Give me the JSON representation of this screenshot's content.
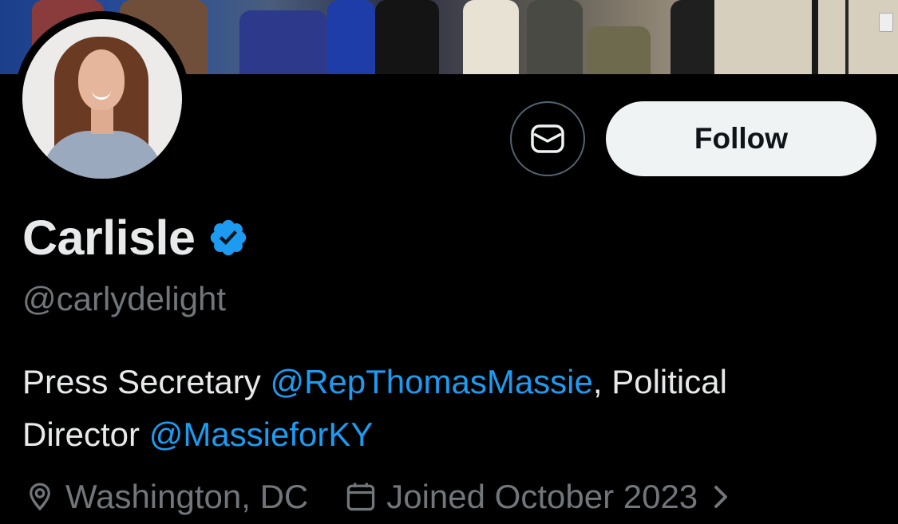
{
  "profile": {
    "display_name": "Carlisle",
    "handle": "@carlydelight",
    "verified": true,
    "verified_color": "#1d9bf0"
  },
  "actions": {
    "follow_label": "Follow",
    "message_icon": "envelope-icon"
  },
  "bio": {
    "line1_text": "Press Secretary ",
    "mention1": "@RepThomasMassie",
    "line1_tail": ", Political",
    "line2_text": "Director ",
    "mention2": "@MassieforKY"
  },
  "meta": {
    "location": "Washington, DC",
    "location_icon": "location-pin-icon",
    "joined": "Joined October 2023",
    "joined_icon": "calendar-icon"
  },
  "colors": {
    "background": "#000000",
    "text_primary": "#e7e9ea",
    "text_secondary": "#71767b",
    "link": "#1d9bf0",
    "follow_button_bg": "#eff3f4"
  }
}
